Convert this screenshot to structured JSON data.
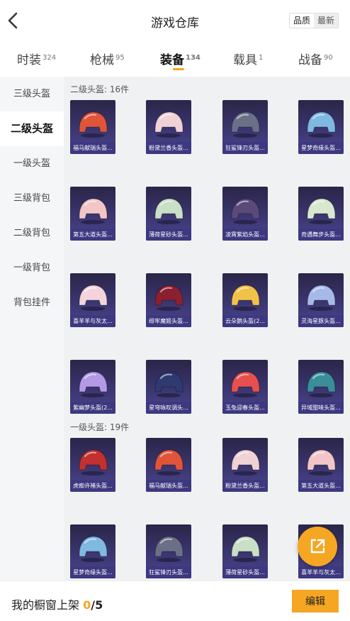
{
  "header": {
    "title": "游戏仓库",
    "sort_options": [
      "品质",
      "最新"
    ]
  },
  "tabs": [
    {
      "label": "时装",
      "count": "324"
    },
    {
      "label": "枪械",
      "count": "95"
    },
    {
      "label": "装备",
      "count": "134"
    },
    {
      "label": "载具",
      "count": "1"
    },
    {
      "label": "战备",
      "count": "90"
    }
  ],
  "sidebar": {
    "items": [
      "三级头盔",
      "二级头盔",
      "一级头盔",
      "三级背包",
      "二级背包",
      "一级背包",
      "背包挂件"
    ]
  },
  "sections": [
    {
      "title": "二级头盔: 16件",
      "items": [
        {
          "name": "福马献瑞头盔...",
          "color": "#e0553a"
        },
        {
          "name": "粉黛兰香头盔...",
          "color": "#f0d2d6"
        },
        {
          "name": "狂鲨锋刃头盔...",
          "color": "#6b7088"
        },
        {
          "name": "星梦奇缘头盔...",
          "color": "#7fb8e0"
        },
        {
          "name": "第五大道头盔...",
          "color": "#f2c6c8"
        },
        {
          "name": "薄荷星砂头盔...",
          "color": "#c9dfc6"
        },
        {
          "name": "凌霄紫焰头盔...",
          "color": "#5a4a7a"
        },
        {
          "name": "奇遇舞步头盔...",
          "color": "#d8e8d0"
        },
        {
          "name": "喜羊羊与灰太...",
          "color": "#f4d4dc"
        },
        {
          "name": "绯牢魔姬头盔...",
          "color": "#8a2030"
        },
        {
          "name": "云朵鹅头盔(2...",
          "color": "#f2c14a"
        },
        {
          "name": "灵海星豚头盔...",
          "color": "#a7b9e8"
        },
        {
          "name": "紫幽梦头盔(2...",
          "color": "#b49ae6"
        },
        {
          "name": "星穹咏叹调头...",
          "color": "#2e3a70"
        },
        {
          "name": "玉兔迎春头盔...",
          "color": "#e85050"
        },
        {
          "name": "异域甜味头盔...",
          "color": "#3a8e9a"
        }
      ]
    },
    {
      "title": "一级头盔: 19件",
      "items": [
        {
          "name": "虎痴许褚头盔...",
          "color": "#c23030"
        },
        {
          "name": "福马献瑞头盔...",
          "color": "#e0553a"
        },
        {
          "name": "粉黛兰香头盔...",
          "color": "#f0d2d6"
        },
        {
          "name": "第五大道头盔...",
          "color": "#f2c6c8"
        },
        {
          "name": "星梦奇缘头盔...",
          "color": "#7fb8e0"
        },
        {
          "name": "狂鲨锋刃头盔...",
          "color": "#6b7088"
        },
        {
          "name": "薄荷星砂头盔...",
          "color": "#c9dfc6"
        },
        {
          "name": "喜羊羊与灰太...",
          "color": "#f4d4dc"
        }
      ]
    }
  ],
  "bottom": {
    "label": "我的橱窗上架",
    "count": "0",
    "total": "/5",
    "edit_label": "编辑"
  },
  "colors": {
    "accent": "#f5a623",
    "card_bg": "#3b3670"
  },
  "icons": {
    "back": "chevron-left-icon",
    "share": "share-icon"
  }
}
